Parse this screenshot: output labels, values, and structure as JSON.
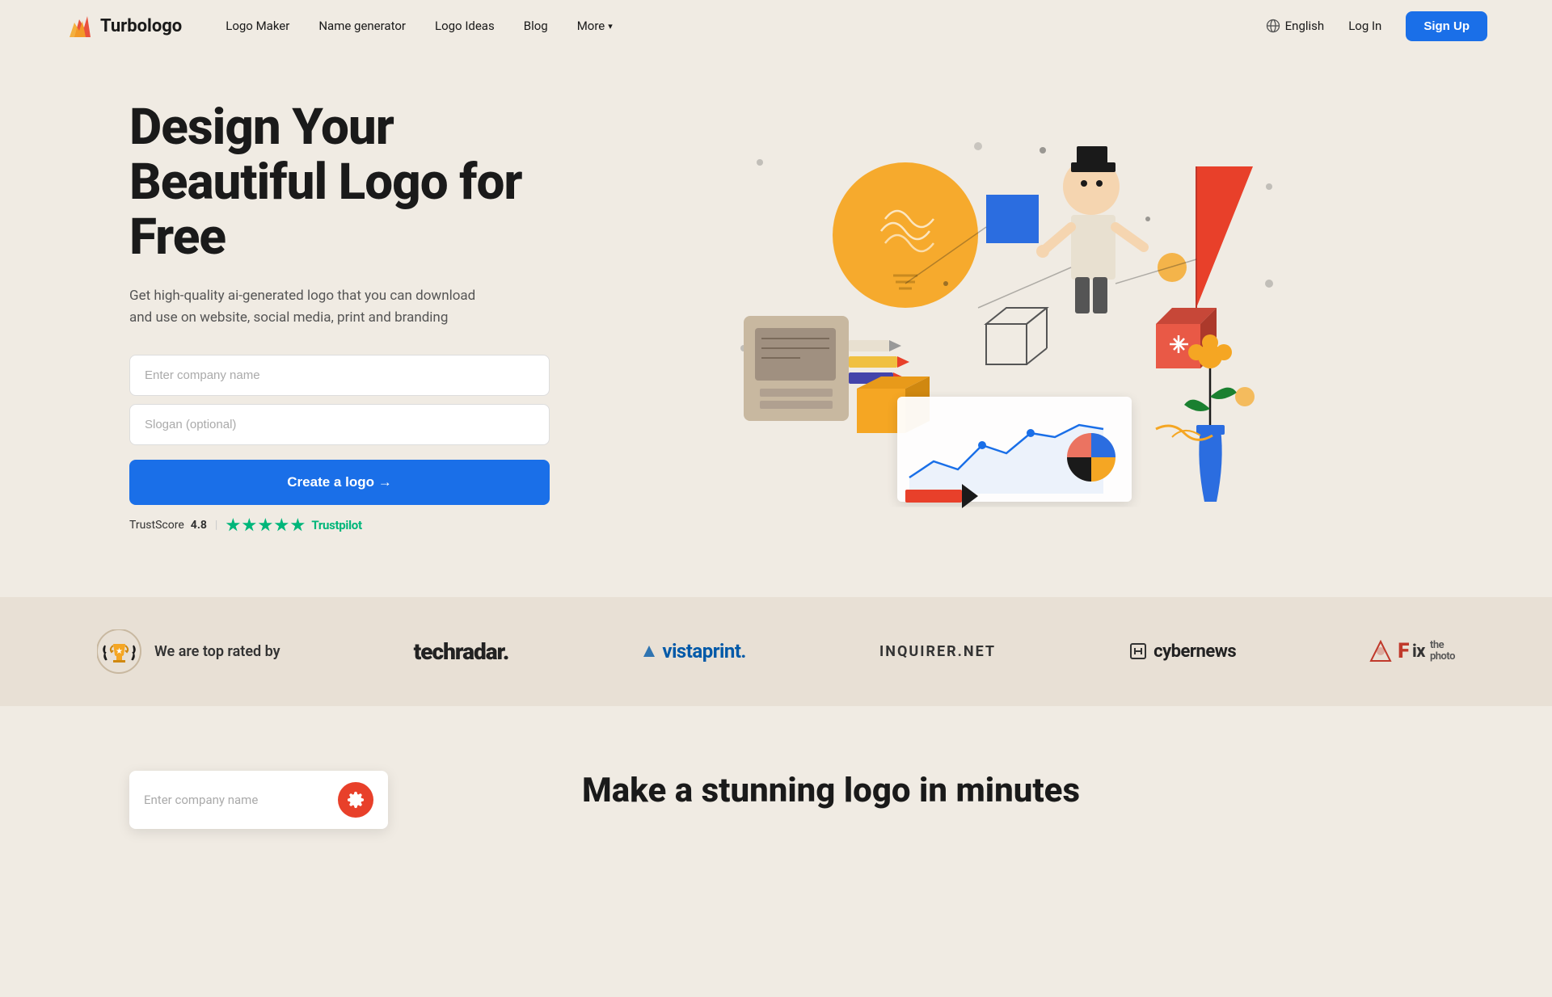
{
  "nav": {
    "logo_text": "Turbologo",
    "links": [
      {
        "label": "Logo Maker",
        "id": "logo-maker"
      },
      {
        "label": "Name generator",
        "id": "name-generator"
      },
      {
        "label": "Logo Ideas",
        "id": "logo-ideas"
      },
      {
        "label": "Blog",
        "id": "blog"
      },
      {
        "label": "More",
        "id": "more"
      }
    ],
    "language": "English",
    "login_label": "Log In",
    "signup_label": "Sign Up"
  },
  "hero": {
    "title": "Design Your Beautiful Logo for Free",
    "subtitle": "Get high-quality ai-generated logo that you can download and use on website, social media, print and branding",
    "company_placeholder": "Enter company name",
    "slogan_placeholder": "Slogan (optional)",
    "cta_label": "Create a logo →",
    "trust_score_label": "TrustScore",
    "trust_score_value": "4.8",
    "trust_separator": "|",
    "trustpilot_label": "Trustpilot"
  },
  "rated_bar": {
    "label": "We are top rated by",
    "partners": [
      {
        "name": "techradar",
        "display": "techradar.",
        "style": "techradar"
      },
      {
        "name": "vistaprint",
        "display": "▼ vistaprint.",
        "style": "vistaprint"
      },
      {
        "name": "inquirer",
        "display": "INQUIRER.NET",
        "style": "inquirer"
      },
      {
        "name": "cybernews",
        "display": "⊞ cybernews",
        "style": "cybernews"
      },
      {
        "name": "fixphoto",
        "display": "⬡Fix the photo",
        "style": "fixphoto"
      }
    ]
  },
  "second_section": {
    "title": "Make a stunning logo in minutes"
  },
  "colors": {
    "primary": "#1a6fe8",
    "background": "#f0ebe3",
    "cta_bg": "#1a6fe8",
    "accent_red": "#e8402a",
    "accent_yellow": "#f5a623",
    "accent_blue": "#2b6de0",
    "trustpilot_green": "#00b67a"
  }
}
